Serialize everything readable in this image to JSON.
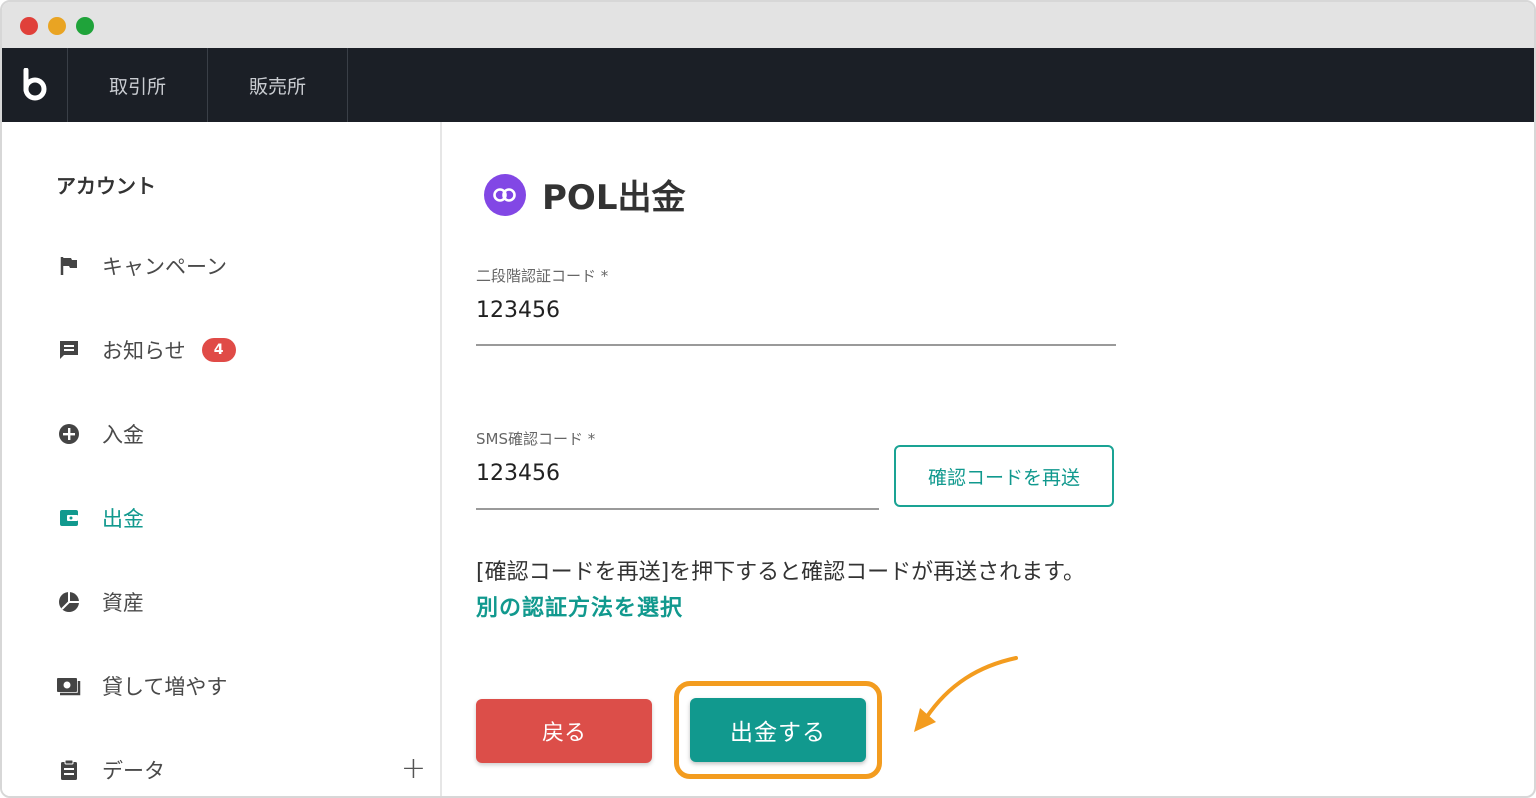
{
  "window": {
    "controls": [
      "close",
      "minimize",
      "maximize"
    ]
  },
  "topnav": {
    "logo_icon": "bitbank-logo-icon",
    "tabs": [
      "取引所",
      "販売所"
    ]
  },
  "sidebar": {
    "heading": "アカウント",
    "items": [
      {
        "label": "キャンペーン",
        "icon": "flag-icon"
      },
      {
        "label": "お知らせ",
        "icon": "message-icon",
        "badge": "4"
      },
      {
        "label": "入金",
        "icon": "plus-circle-icon"
      },
      {
        "label": "出金",
        "icon": "wallet-icon",
        "active": true
      },
      {
        "label": "資産",
        "icon": "pie-chart-icon"
      },
      {
        "label": "貸して増やす",
        "icon": "cash-icon"
      },
      {
        "label": "データ",
        "icon": "clipboard-icon",
        "expand": "+"
      }
    ]
  },
  "main": {
    "title": "POL出金",
    "coin_icon": "polygon-icon",
    "twofa": {
      "label": "二段階認証コード *",
      "value": "123456"
    },
    "sms": {
      "label": "SMS確認コード *",
      "value": "123456"
    },
    "resend_button": "確認コードを再送",
    "help_text": "[確認コードを再送]を押下すると確認コードが再送されます。",
    "alt_link": "別の認証方法を選択",
    "back_button": "戻る",
    "submit_button": "出金する"
  },
  "colors": {
    "accent": "#11998e",
    "danger": "#dc4e49",
    "highlight": "#f39c1f",
    "topnav": "#1b1f26",
    "polygon": "#8247e5",
    "badge": "#e04b47"
  }
}
